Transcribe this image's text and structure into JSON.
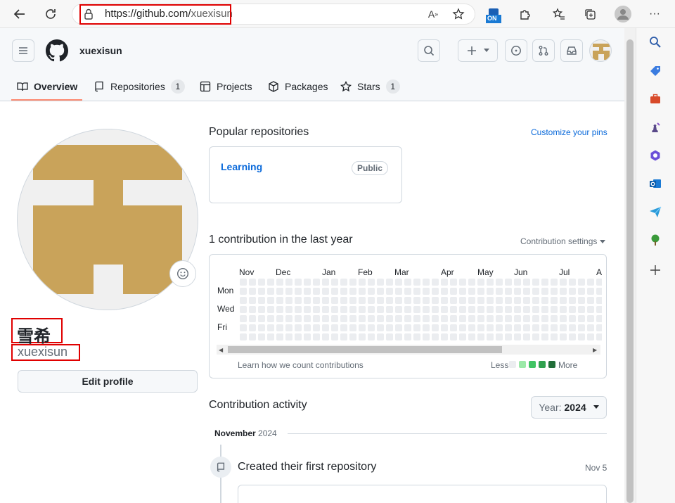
{
  "browser": {
    "url_domain": "https://github.com/",
    "url_path": "xuexisun",
    "tracking_badge": "ON"
  },
  "header": {
    "username": "xuexisun"
  },
  "tabs": [
    {
      "label": "Overview",
      "count": null
    },
    {
      "label": "Repositories",
      "count": "1"
    },
    {
      "label": "Projects",
      "count": null
    },
    {
      "label": "Packages",
      "count": null
    },
    {
      "label": "Stars",
      "count": "1"
    }
  ],
  "profile": {
    "display_name": "雪希",
    "login": "xuexisun",
    "edit_button": "Edit profile",
    "avatar_color": "#c9a35a"
  },
  "popular": {
    "title": "Popular repositories",
    "customize_link": "Customize your pins",
    "repos": [
      {
        "name": "Learning",
        "visibility": "Public"
      }
    ]
  },
  "contributions": {
    "title": "1 contribution in the last year",
    "settings": "Contribution settings",
    "months": [
      "Nov",
      "Dec",
      "Jan",
      "Feb",
      "Mar",
      "Apr",
      "May",
      "Jun",
      "Jul",
      "A"
    ],
    "days": [
      "Mon",
      "Wed",
      "Fri"
    ],
    "learn_link": "Learn how we count contributions",
    "less": "Less",
    "more": "More",
    "legend_colors": [
      "#ebedf0",
      "#9be9a8",
      "#40c463",
      "#30a14e",
      "#216e39"
    ]
  },
  "activity": {
    "title": "Contribution activity",
    "year_label": "Year:",
    "year_value": "2024",
    "month_heading": "November",
    "month_year": "2024",
    "event_text": "Created their first repository",
    "event_date": "Nov 5"
  }
}
